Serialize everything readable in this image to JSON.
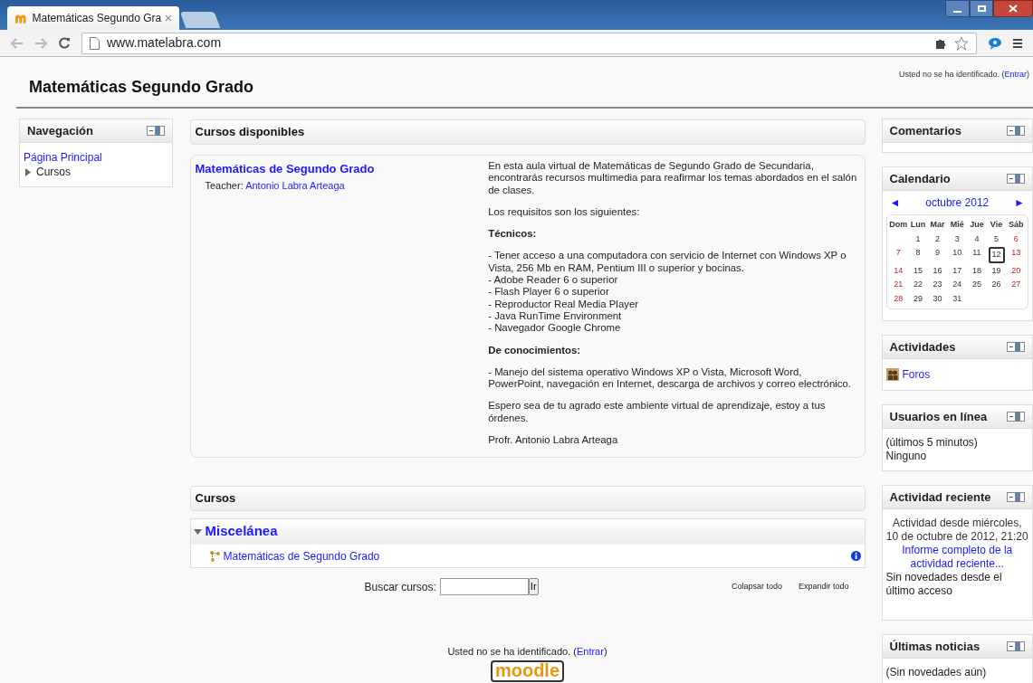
{
  "browser": {
    "tab_title": "Matemáticas Segundo Gra",
    "url": "www.matelabra.com"
  },
  "header": {
    "title": "Matemáticas Segundo Grado",
    "login_text": "Usted no se ha identificado.",
    "login_open": "(",
    "login_link": "Entrar",
    "login_close": ")"
  },
  "navigation": {
    "title": "Navegación",
    "items": [
      {
        "label": "Página Principal",
        "kind": "link"
      },
      {
        "label": "Cursos",
        "kind": "branch",
        "expanded": false
      }
    ]
  },
  "available": {
    "title": "Cursos disponibles",
    "course": {
      "name": "Matemáticas de Segundo Grado",
      "teacher_label": "Teacher:",
      "teacher": "Antonio Labra Arteaga"
    },
    "summary": [
      {
        "kind": "text",
        "text": "En esta aula virtual de Matemáticas de Segundo Grado de Secundaria, encontrarás recursos multimedia para reafirmar los temas abordados en el salón de clases."
      },
      {
        "kind": "text",
        "text": "Los requisitos son los siguientes:"
      },
      {
        "kind": "heading",
        "text": "Técnicos:"
      },
      {
        "kind": "lines",
        "lines": [
          "- Tener acceso a una computadora con servicio de Internet con Windows XP o Vista, 256 Mb en RAM, Pentium III o superior y bocinas.",
          "- Adobe Reader 6 o superior",
          "- Flash Player 6 o superior",
          "- Reproductor Real Media Player",
          "- Java RunTime Environment",
          "- Navegador Google Chrome"
        ]
      },
      {
        "kind": "heading",
        "text": "De conocimientos:"
      },
      {
        "kind": "text",
        "text": "- Manejo del sistema operativo Windows XP o Vista, Microsoft Word, PowerPoint, navegación en Internet, descarga de archivos y correo electrónico."
      },
      {
        "kind": "text",
        "text": "Espero sea de tu agrado este ambiente virtual de aprendizaje,  estoy a tus órdenes."
      },
      {
        "kind": "text",
        "text": "Profr. Antonio Labra Arteaga"
      }
    ]
  },
  "courses": {
    "title": "Cursos",
    "category": {
      "name": "Miscelánea",
      "expanded": true,
      "courses": [
        {
          "name": "Matemáticas de Segundo Grado"
        }
      ]
    },
    "search_label": "Buscar cursos:",
    "search_button": "Ir",
    "collapse_all": "Colapsar todo",
    "expand_all": "Expandir todo"
  },
  "footer": {
    "login_text": "Usted no se ha identificado.",
    "login_open": "(",
    "login_link": "Entrar",
    "login_close": ")",
    "logo": "moodle"
  },
  "blocks": [
    {
      "kind": "empty",
      "title": "Comentarios"
    },
    {
      "kind": "calendar",
      "title": "Calendario",
      "prev": "◄",
      "month": "octubre 2012",
      "next": "►",
      "weekdays": [
        "Dom",
        "Lun",
        "Mar",
        "Mié",
        "Jue",
        "Vie",
        "Sáb"
      ],
      "weeks": [
        {
          "kind": "first",
          "days": [
            {
              "day": "1",
              "today": false
            },
            {
              "day": "2",
              "today": false
            },
            {
              "day": "3",
              "today": false
            },
            {
              "day": "4",
              "today": false
            },
            {
              "day": "5",
              "today": false
            },
            {
              "day": "6",
              "today": false
            }
          ]
        },
        {
          "kind": "regular",
          "days": [
            {
              "day": "7",
              "today": false
            },
            {
              "day": "8",
              "today": false
            },
            {
              "day": "9",
              "today": false
            },
            {
              "day": "10",
              "today": false
            },
            {
              "day": "11",
              "today": false
            },
            {
              "day": "12",
              "today": true
            },
            {
              "day": "13",
              "today": false
            }
          ]
        },
        {
          "kind": "regular",
          "days": [
            {
              "day": "14",
              "today": false
            },
            {
              "day": "15",
              "today": false
            },
            {
              "day": "16",
              "today": false
            },
            {
              "day": "17",
              "today": false
            },
            {
              "day": "18",
              "today": false
            },
            {
              "day": "19",
              "today": false
            },
            {
              "day": "20",
              "today": false
            }
          ]
        },
        {
          "kind": "regular",
          "days": [
            {
              "day": "21",
              "today": false
            },
            {
              "day": "22",
              "today": false
            },
            {
              "day": "23",
              "today": false
            },
            {
              "day": "24",
              "today": false
            },
            {
              "day": "25",
              "today": false
            },
            {
              "day": "26",
              "today": false
            },
            {
              "day": "27",
              "today": false
            }
          ]
        },
        {
          "kind": "regular",
          "days": [
            {
              "day": "28",
              "today": false
            },
            {
              "day": "29",
              "today": false
            },
            {
              "day": "30",
              "today": false
            },
            {
              "day": "31",
              "today": false
            }
          ]
        }
      ]
    },
    {
      "kind": "activities",
      "title": "Actividades",
      "items": [
        "Foros"
      ]
    },
    {
      "kind": "lines",
      "title": "Usuarios en línea",
      "lines": [
        "(últimos 5 minutos)",
        "Ninguno"
      ]
    },
    {
      "kind": "recent",
      "title": "Actividad reciente",
      "since": "Actividad desde miércoles, 10 de octubre de 2012, 21:20",
      "link": "Informe completo de la actividad reciente...",
      "note": "Sin novedades desde el último acceso"
    },
    {
      "kind": "lines",
      "title": "Últimas noticias",
      "lines": [
        "(Sin novedades aún)"
      ]
    }
  ]
}
